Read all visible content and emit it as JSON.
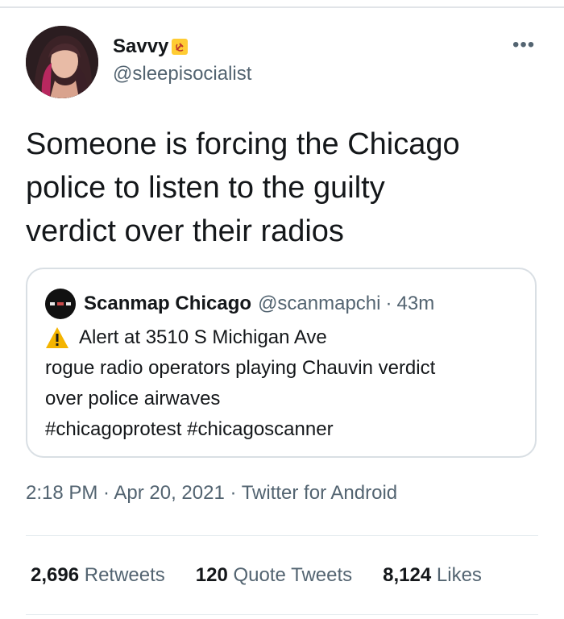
{
  "author": {
    "name": "Savvy",
    "handle": "@sleepisocialist",
    "badge_icon": "hammer-sickle-icon"
  },
  "tweet": {
    "text_lines": [
      "Someone is forcing the Chicago",
      "police to listen to the guilty",
      "verdict over their radios"
    ]
  },
  "quote": {
    "name": "Scanmap Chicago",
    "handle": "@scanmapchi",
    "separator": "·",
    "time": "43m",
    "lines": [
      "Alert at 3510 S Michigan Ave",
      "rogue radio operators playing Chauvin verdict",
      "over police airwaves",
      "#chicagoprotest #chicagoscanner"
    ]
  },
  "meta": {
    "text": "2:18 PM · Apr 20, 2021 · Twitter for Android"
  },
  "stats": {
    "retweets": {
      "count": "2,696",
      "label": "Retweets"
    },
    "quotes": {
      "count": "120",
      "label": "Quote Tweets"
    },
    "likes": {
      "count": "8,124",
      "label": "Likes"
    }
  },
  "colors": {
    "text": "#14171a",
    "secondary": "#536471",
    "border": "#d9dfe4",
    "badge": "#ffcc33",
    "warning": "#f4b400"
  }
}
